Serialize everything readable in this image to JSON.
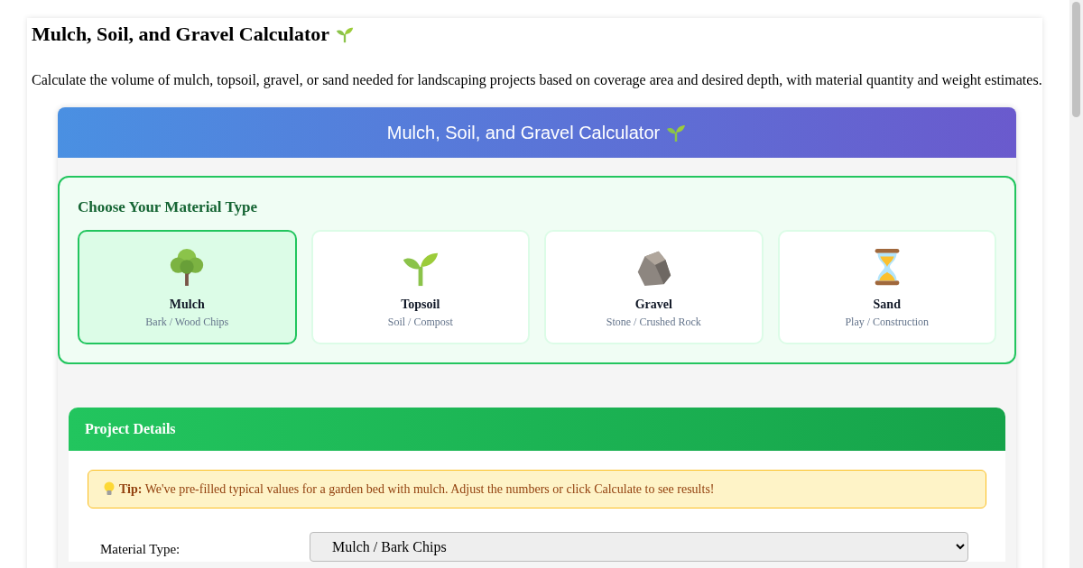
{
  "page": {
    "title": "Mulch, Soil, and Gravel Calculator",
    "description": "Calculate the volume of mulch, topsoil, gravel, or sand needed for landscaping projects based on coverage area and desired depth, with material quantity and weight estimates."
  },
  "calculator": {
    "header": "Mulch, Soil, and Gravel Calculator"
  },
  "material_section": {
    "heading": "Choose Your Material Type",
    "materials": [
      {
        "kind": "tree",
        "name": "Mulch",
        "subtitle": "Bark / Wood Chips",
        "selected": true
      },
      {
        "kind": "sprout",
        "name": "Topsoil",
        "subtitle": "Soil / Compost",
        "selected": false
      },
      {
        "kind": "rock",
        "name": "Gravel",
        "subtitle": "Stone / Crushed Rock",
        "selected": false
      },
      {
        "kind": "hourglass",
        "name": "Sand",
        "subtitle": "Play / Construction",
        "selected": false
      }
    ]
  },
  "project_details": {
    "heading": "Project Details",
    "tip": "**Tip:** We've pre-filled typical values for a garden bed with mulch. Adjust the numbers or click Calculate to see results!",
    "fields": [
      {
        "label": "Material Type:",
        "value": "Mulch / Bark Chips"
      }
    ]
  }
}
